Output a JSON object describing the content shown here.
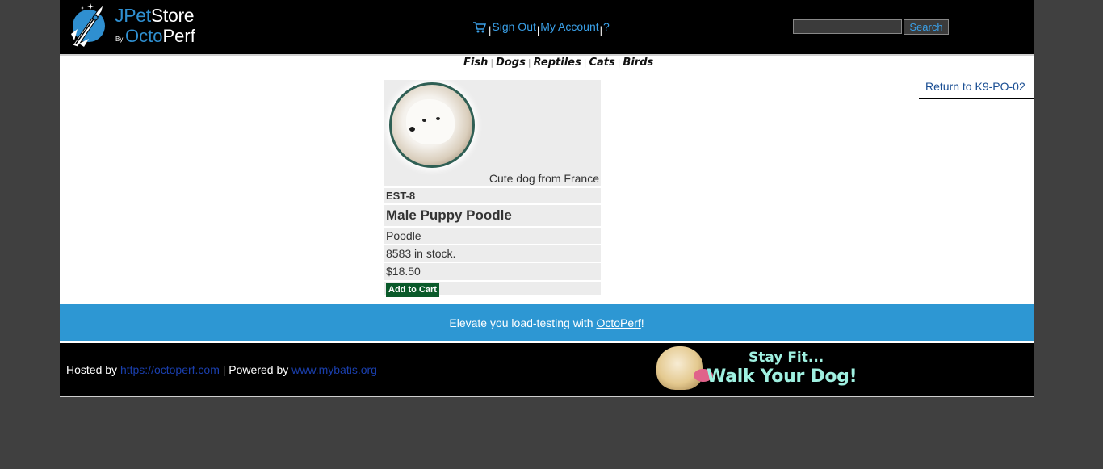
{
  "header": {
    "brand_jpet": "JPet",
    "brand_store": "Store",
    "brand_by": "By",
    "brand_octo": "Octo",
    "brand_perf": "Perf",
    "menu": {
      "sign_out": "Sign Out",
      "my_account": "My Account",
      "help": "?",
      "separator": "|"
    },
    "search": {
      "value": "",
      "button_label": "Search"
    }
  },
  "quicklinks": [
    "Fish",
    "Dogs",
    "Reptiles",
    "Cats",
    "Birds"
  ],
  "back_link": "Return to K9-PO-02",
  "item": {
    "caption": "Cute dog from France",
    "id": "EST-8",
    "name": "Male Puppy Poodle",
    "attribute": "Poodle",
    "stock": "8583 in stock.",
    "price": "$18.50",
    "add_to_cart": "Add to Cart"
  },
  "banner": {
    "text_before": "Elevate you load-testing with ",
    "link": "OctoPerf",
    "text_after": "!"
  },
  "footer": {
    "hosted_by": "Hosted by ",
    "hosted_link": "https://octoperf.com",
    "powered_by": " | Powered by ",
    "powered_link": "www.mybatis.org",
    "ad_line1": "Stay Fit...",
    "ad_line2": "Walk Your Dog!"
  }
}
